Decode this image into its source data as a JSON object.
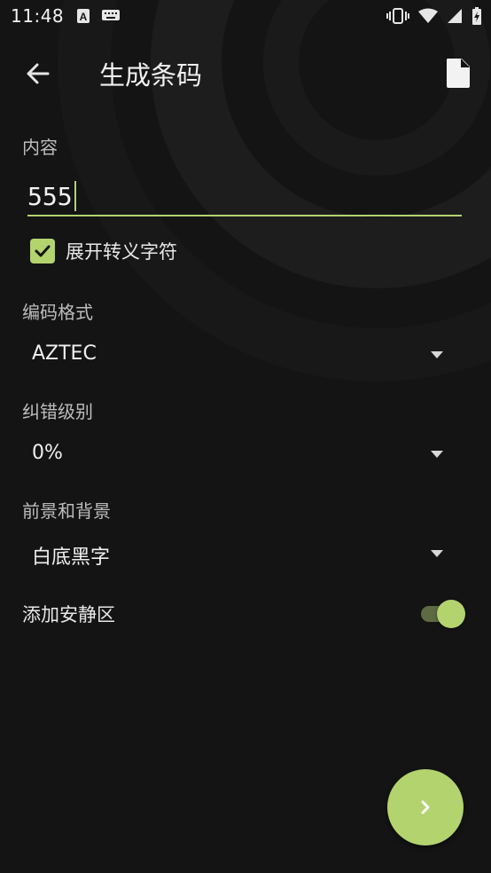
{
  "status_bar": {
    "time": "11:48",
    "icons": [
      "text-a-icon",
      "keyboard-icon",
      "vibrate-icon",
      "wifi-icon",
      "signal-icon",
      "battery-icon"
    ]
  },
  "app_bar": {
    "title": "生成条码",
    "back_icon": "arrow-left-icon",
    "action_icon": "file-icon"
  },
  "content_section": {
    "label": "内容",
    "input_value": "555",
    "checkbox_label": "展开转义字符",
    "checkbox_checked": true
  },
  "encoding_section": {
    "label": "编码格式",
    "selected": "AZTEC"
  },
  "error_correction_section": {
    "label": "纠错级别",
    "selected": "0%"
  },
  "colors_section": {
    "label": "前景和背景",
    "selected": "白底黑字"
  },
  "quiet_zone": {
    "label": "添加安静区",
    "enabled": true
  },
  "fab": {
    "icon": "chevron-right-icon"
  },
  "colors": {
    "accent": "#b3d36e",
    "background": "#141414"
  }
}
